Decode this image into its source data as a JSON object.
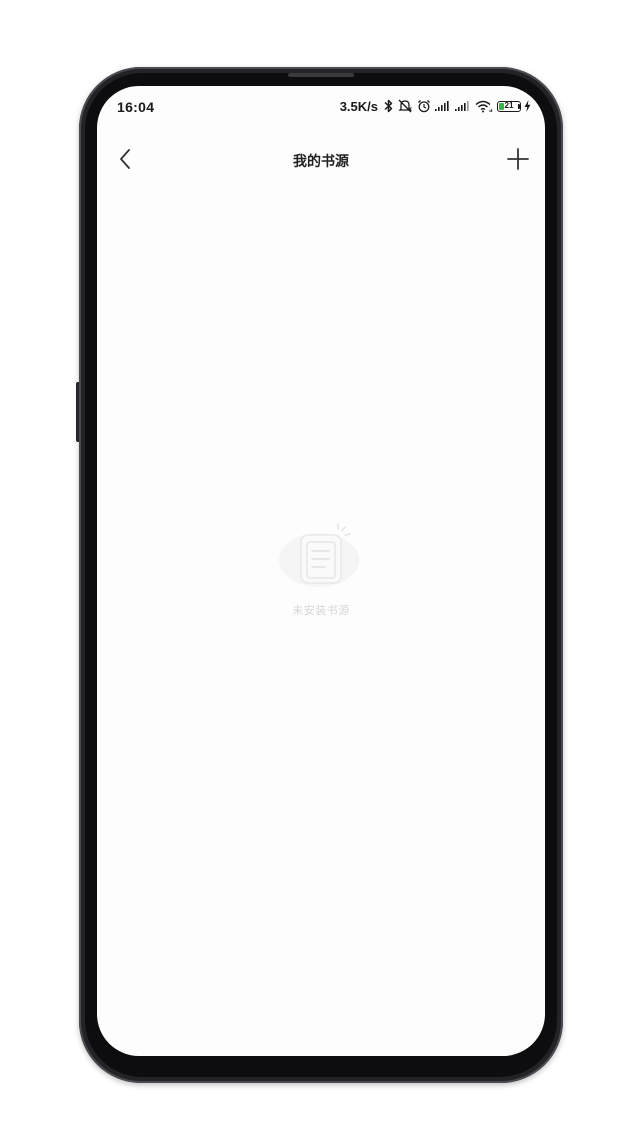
{
  "status_bar": {
    "time": "16:04",
    "net_speed": "3.5K/s",
    "battery_level": "21",
    "battery_color": "#3cb34a",
    "icons": [
      "bluetooth-icon",
      "mute-icon",
      "alarm-icon",
      "signal-icon",
      "signal-icon",
      "wifi-icon",
      "battery-icon",
      "charging-icon"
    ]
  },
  "navbar": {
    "title": "我的书源",
    "back_icon": "chevron-left-icon",
    "add_icon": "plus-icon"
  },
  "empty_state": {
    "icon": "document-icon",
    "message": "未安装书源"
  }
}
